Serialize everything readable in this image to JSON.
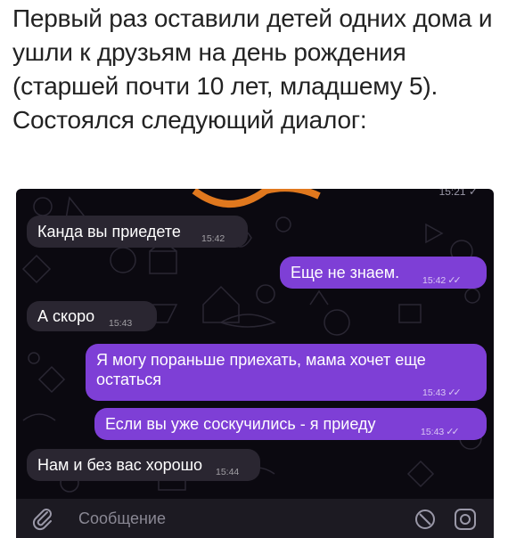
{
  "post": {
    "text": "Первый раз оставили детей одних дома и ушли к друзьям на день рождения (старшей почти 10 лет, младшему 5). Состоялся следующий диалог:"
  },
  "chat": {
    "top_status": "15:21 ✓",
    "messages": [
      {
        "text": "Канда вы приедете",
        "time": "15:42",
        "direction": "incoming"
      },
      {
        "text": "Еще не знаем.",
        "time": "15:42",
        "direction": "outgoing",
        "read": true
      },
      {
        "text": "А скоро",
        "time": "15:43",
        "direction": "incoming"
      },
      {
        "text": "Я могу пораньше приехать, мама хочет еще остаться",
        "time": "15:43",
        "direction": "outgoing",
        "read": true
      },
      {
        "text": "Если вы уже соскучились - я приеду",
        "time": "15:43",
        "direction": "outgoing",
        "read": true
      },
      {
        "text": "Нам и без вас хорошо",
        "time": "15:44",
        "direction": "incoming"
      }
    ],
    "input": {
      "placeholder": "Сообщение",
      "left_icon": "paperclip-icon",
      "right_icons": [
        "clock-icon",
        "camera-icon"
      ]
    },
    "colors": {
      "background": "#0b0910",
      "incoming_bubble": "#2a2631",
      "outgoing_bubble": "#7e3fd6",
      "input_bar": "#1c1a22"
    }
  }
}
